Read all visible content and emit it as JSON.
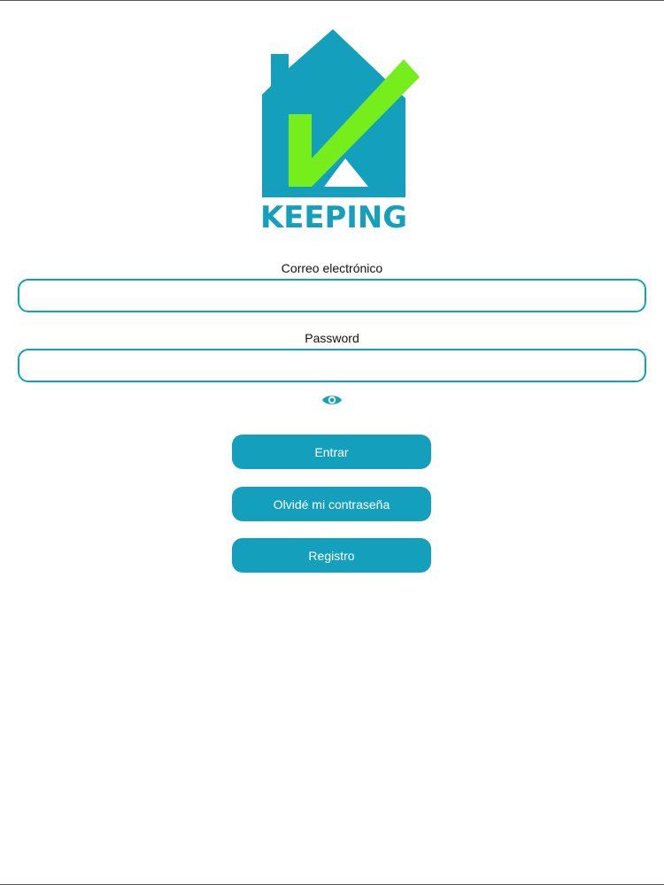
{
  "logo": {
    "brand_text": "KEEPING",
    "colors": {
      "house": "#14a0bd",
      "check": "#76ee1c",
      "white": "#ffffff"
    }
  },
  "form": {
    "email": {
      "label": "Correo electrónico",
      "value": "",
      "placeholder": ""
    },
    "password": {
      "label": "Password",
      "value": "",
      "placeholder": ""
    },
    "show_password_icon": "eye-icon"
  },
  "buttons": {
    "login": "Entrar",
    "forgot": "Olvidé mi contraseña",
    "register": "Registro"
  },
  "theme": {
    "accent": "#14a0bd"
  }
}
